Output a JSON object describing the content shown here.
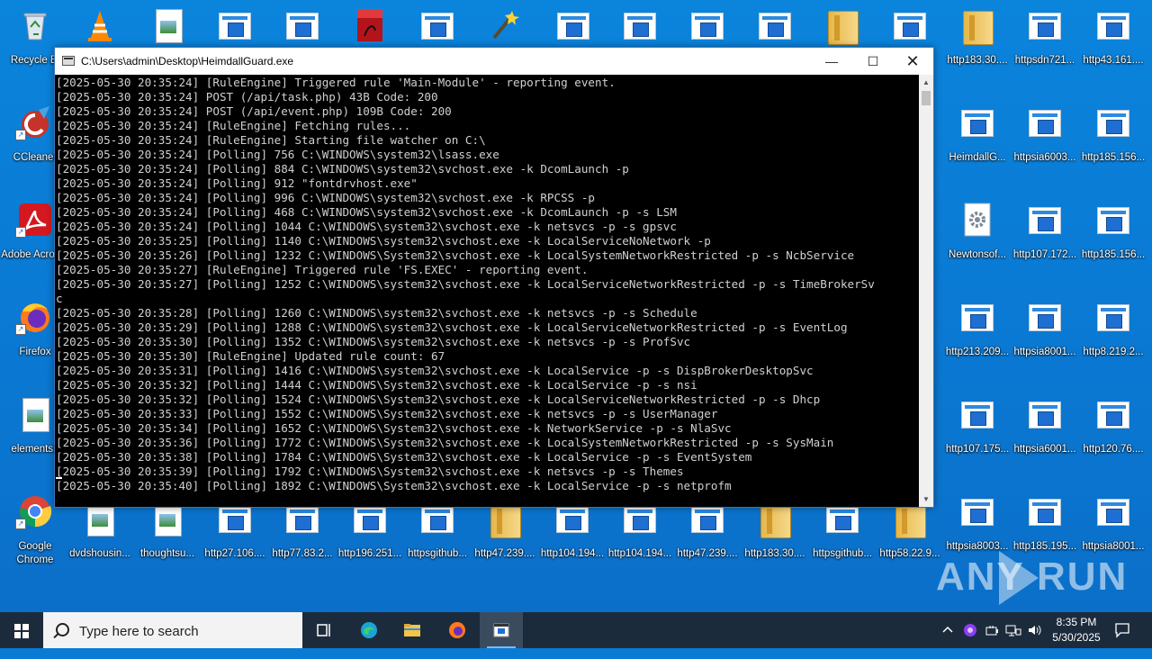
{
  "desktop": {
    "left_icons": [
      {
        "label": "Recycle Bin",
        "shown": "Recycle Bi"
      },
      {
        "label": "CCleaner",
        "shown": "CCleaner"
      },
      {
        "label": "Adobe Acrobat",
        "shown": "Adobe Acrobat"
      },
      {
        "label": "Firefox",
        "shown": "Firefox"
      },
      {
        "label": "elementsb",
        "shown": "elementsb"
      },
      {
        "label": "Google Chrome",
        "shown": "Google Chrome"
      }
    ],
    "right_icons": [
      "http183.30....",
      "httpsdn721...",
      "http43.161....",
      "HeimdallG...",
      "httpsia6003...",
      "http185.156...",
      "Newtonsof...",
      "http107.172...",
      "http185.156...",
      "http213.209...",
      "httpsia8001...",
      "http8.219.2...",
      "http107.175...",
      "httpsia6001...",
      "http120.76....",
      "httpsia8003...",
      "http185.195...",
      "httpsia8001..."
    ],
    "bottom_icons": [
      "dvdshousin...",
      "thoughtsu...",
      "http27.106....",
      "http77.83.2...",
      "http196.251...",
      "httpsgithub...",
      "http47.239....",
      "http104.194...",
      "http104.194...",
      "http47.239....",
      "http183.30....",
      "httpsgithub...",
      "http58.22.9..."
    ]
  },
  "window": {
    "title": "C:\\Users\\admin\\Desktop\\HeimdallGuard.exe",
    "minimize": "—",
    "maximize": "☐",
    "close": "✕",
    "lines": [
      "[2025-05-30 20:35:24] [RuleEngine] Triggered rule 'Main-Module' - reporting event.",
      "[2025-05-30 20:35:24] POST (/api/task.php) 43B Code: 200",
      "[2025-05-30 20:35:24] POST (/api/event.php) 109B Code: 200",
      "[2025-05-30 20:35:24] [RuleEngine] Fetching rules...",
      "[2025-05-30 20:35:24] [RuleEngine] Starting file watcher on C:\\",
      "[2025-05-30 20:35:24] [Polling] 756 C:\\WINDOWS\\system32\\lsass.exe",
      "[2025-05-30 20:35:24] [Polling] 884 C:\\WINDOWS\\system32\\svchost.exe -k DcomLaunch -p",
      "[2025-05-30 20:35:24] [Polling] 912 \"fontdrvhost.exe\"",
      "[2025-05-30 20:35:24] [Polling] 996 C:\\WINDOWS\\system32\\svchost.exe -k RPCSS -p",
      "[2025-05-30 20:35:24] [Polling] 468 C:\\WINDOWS\\system32\\svchost.exe -k DcomLaunch -p -s LSM",
      "[2025-05-30 20:35:24] [Polling] 1044 C:\\WINDOWS\\system32\\svchost.exe -k netsvcs -p -s gpsvc",
      "[2025-05-30 20:35:25] [Polling] 1140 C:\\WINDOWS\\system32\\svchost.exe -k LocalServiceNoNetwork -p",
      "[2025-05-30 20:35:26] [Polling] 1232 C:\\WINDOWS\\System32\\svchost.exe -k LocalSystemNetworkRestricted -p -s NcbService",
      "[2025-05-30 20:35:27] [RuleEngine] Triggered rule 'FS.EXEC' - reporting event.",
      "[2025-05-30 20:35:27] [Polling] 1252 C:\\WINDOWS\\system32\\svchost.exe -k LocalServiceNetworkRestricted -p -s TimeBrokerSv",
      "c",
      "[2025-05-30 20:35:28] [Polling] 1260 C:\\WINDOWS\\system32\\svchost.exe -k netsvcs -p -s Schedule",
      "[2025-05-30 20:35:29] [Polling] 1288 C:\\WINDOWS\\system32\\svchost.exe -k LocalServiceNetworkRestricted -p -s EventLog",
      "[2025-05-30 20:35:30] [Polling] 1352 C:\\WINDOWS\\system32\\svchost.exe -k netsvcs -p -s ProfSvc",
      "[2025-05-30 20:35:30] [RuleEngine] Updated rule count: 67",
      "[2025-05-30 20:35:31] [Polling] 1416 C:\\WINDOWS\\system32\\svchost.exe -k LocalService -p -s DispBrokerDesktopSvc",
      "[2025-05-30 20:35:32] [Polling] 1444 C:\\WINDOWS\\System32\\svchost.exe -k LocalService -p -s nsi",
      "[2025-05-30 20:35:32] [Polling] 1524 C:\\WINDOWS\\System32\\svchost.exe -k LocalServiceNetworkRestricted -p -s Dhcp",
      "[2025-05-30 20:35:33] [Polling] 1552 C:\\WINDOWS\\System32\\svchost.exe -k netsvcs -p -s UserManager",
      "[2025-05-30 20:35:34] [Polling] 1652 C:\\WINDOWS\\System32\\svchost.exe -k NetworkService -p -s NlaSvc",
      "[2025-05-30 20:35:36] [Polling] 1772 C:\\WINDOWS\\System32\\svchost.exe -k LocalSystemNetworkRestricted -p -s SysMain",
      "[2025-05-30 20:35:38] [Polling] 1784 C:\\WINDOWS\\System32\\svchost.exe -k LocalService -p -s EventSystem",
      "[2025-05-30 20:35:39] [Polling] 1792 C:\\WINDOWS\\System32\\svchost.exe -k netsvcs -p -s Themes",
      "[2025-05-30 20:35:40] [Polling] 1892 C:\\WINDOWS\\System32\\svchost.exe -k LocalService -p -s netprofm"
    ]
  },
  "watermark": {
    "left": "ANY",
    "right": "RUN"
  },
  "taskbar": {
    "search_placeholder": "Type here to search",
    "time": "8:35 PM",
    "date": "5/30/2025"
  },
  "colors": {
    "desktop": "#0a7bd4",
    "taskbar": "#1c2b3c",
    "console_bg": "#000000",
    "console_text": "#d0d0d0"
  }
}
